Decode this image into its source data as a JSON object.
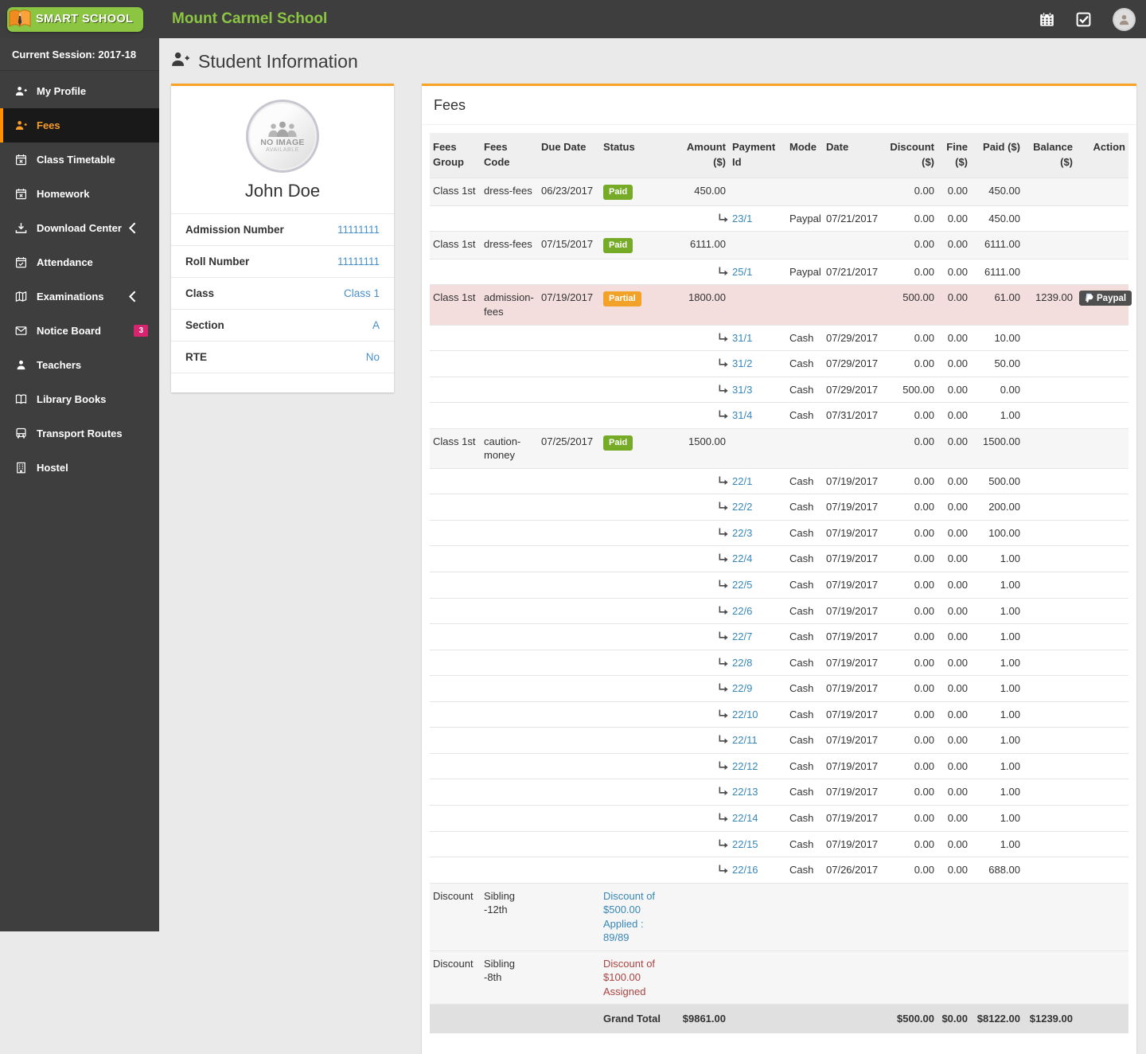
{
  "header": {
    "logo_text": "SMART SCHOOL",
    "school_name": "Mount Carmel School"
  },
  "sidebar": {
    "session_label": "Current Session: 2017-18",
    "items": [
      {
        "label": "My Profile",
        "icon": "user-plus",
        "active": false
      },
      {
        "label": "Fees",
        "icon": "user-plus",
        "active": true
      },
      {
        "label": "Class Timetable",
        "icon": "calendar-x",
        "active": false
      },
      {
        "label": "Homework",
        "icon": "calendar-x",
        "active": false
      },
      {
        "label": "Download Center",
        "icon": "download",
        "active": false,
        "chevron": true
      },
      {
        "label": "Attendance",
        "icon": "calendar-check",
        "active": false
      },
      {
        "label": "Examinations",
        "icon": "map",
        "active": false,
        "chevron": true
      },
      {
        "label": "Notice Board",
        "icon": "envelope",
        "active": false,
        "badge": "3"
      },
      {
        "label": "Teachers",
        "icon": "user",
        "active": false
      },
      {
        "label": "Library Books",
        "icon": "book",
        "active": false
      },
      {
        "label": "Transport Routes",
        "icon": "bus",
        "active": false
      },
      {
        "label": "Hostel",
        "icon": "building",
        "active": false
      }
    ]
  },
  "page": {
    "title": "Student Information"
  },
  "student": {
    "photo": {
      "line1": "NO IMAGE",
      "line2": "AVAILABLE"
    },
    "name": "John Doe",
    "fields": [
      {
        "label": "Admission Number",
        "value": "11111111"
      },
      {
        "label": "Roll Number",
        "value": "11111111"
      },
      {
        "label": "Class",
        "value": "Class 1"
      },
      {
        "label": "Section",
        "value": "A"
      },
      {
        "label": "RTE",
        "value": "No"
      }
    ]
  },
  "fees": {
    "panel_title": "Fees",
    "columns": [
      "Fees Group",
      "Fees Code",
      "Due Date",
      "Status",
      "Amount ($)",
      "Payment Id",
      "Mode",
      "Date",
      "Discount ($)",
      "Fine ($)",
      "Paid ($)",
      "Balance ($)",
      "Action"
    ],
    "rows": [
      {
        "type": "fee",
        "group": "Class 1st",
        "code": "dress-fees",
        "due_date": "06/23/2017",
        "status": "Paid",
        "status_type": "paid",
        "amount": "450.00",
        "discount": "0.00",
        "fine": "0.00",
        "paid": "450.00",
        "balance": "",
        "action": "",
        "highlight": false
      },
      {
        "type": "payment",
        "id": "23/1",
        "mode": "Paypal",
        "date": "07/21/2017",
        "discount": "0.00",
        "fine": "0.00",
        "paid": "450.00"
      },
      {
        "type": "fee",
        "group": "Class 1st",
        "code": "dress-fees",
        "due_date": "07/15/2017",
        "status": "Paid",
        "status_type": "paid",
        "amount": "6111.00",
        "discount": "0.00",
        "fine": "0.00",
        "paid": "6111.00",
        "balance": "",
        "action": "",
        "highlight": false
      },
      {
        "type": "payment",
        "id": "25/1",
        "mode": "Paypal",
        "date": "07/21/2017",
        "discount": "0.00",
        "fine": "0.00",
        "paid": "6111.00"
      },
      {
        "type": "fee",
        "group": "Class 1st",
        "code": "admission-fees",
        "due_date": "07/19/2017",
        "status": "Partial",
        "status_type": "partial",
        "amount": "1800.00",
        "discount": "500.00",
        "fine": "0.00",
        "paid": "61.00",
        "balance": "1239.00",
        "action": "Paypal",
        "highlight": true
      },
      {
        "type": "payment",
        "id": "31/1",
        "mode": "Cash",
        "date": "07/29/2017",
        "discount": "0.00",
        "fine": "0.00",
        "paid": "10.00"
      },
      {
        "type": "payment",
        "id": "31/2",
        "mode": "Cash",
        "date": "07/29/2017",
        "discount": "0.00",
        "fine": "0.00",
        "paid": "50.00"
      },
      {
        "type": "payment",
        "id": "31/3",
        "mode": "Cash",
        "date": "07/29/2017",
        "discount": "500.00",
        "fine": "0.00",
        "paid": "0.00"
      },
      {
        "type": "payment",
        "id": "31/4",
        "mode": "Cash",
        "date": "07/31/2017",
        "discount": "0.00",
        "fine": "0.00",
        "paid": "1.00"
      },
      {
        "type": "fee",
        "group": "Class 1st",
        "code": "caution-money",
        "due_date": "07/25/2017",
        "status": "Paid",
        "status_type": "paid",
        "amount": "1500.00",
        "discount": "0.00",
        "fine": "0.00",
        "paid": "1500.00",
        "balance": "",
        "action": "",
        "highlight": false
      },
      {
        "type": "payment",
        "id": "22/1",
        "mode": "Cash",
        "date": "07/19/2017",
        "discount": "0.00",
        "fine": "0.00",
        "paid": "500.00"
      },
      {
        "type": "payment",
        "id": "22/2",
        "mode": "Cash",
        "date": "07/19/2017",
        "discount": "0.00",
        "fine": "0.00",
        "paid": "200.00"
      },
      {
        "type": "payment",
        "id": "22/3",
        "mode": "Cash",
        "date": "07/19/2017",
        "discount": "0.00",
        "fine": "0.00",
        "paid": "100.00"
      },
      {
        "type": "payment",
        "id": "22/4",
        "mode": "Cash",
        "date": "07/19/2017",
        "discount": "0.00",
        "fine": "0.00",
        "paid": "1.00"
      },
      {
        "type": "payment",
        "id": "22/5",
        "mode": "Cash",
        "date": "07/19/2017",
        "discount": "0.00",
        "fine": "0.00",
        "paid": "1.00"
      },
      {
        "type": "payment",
        "id": "22/6",
        "mode": "Cash",
        "date": "07/19/2017",
        "discount": "0.00",
        "fine": "0.00",
        "paid": "1.00"
      },
      {
        "type": "payment",
        "id": "22/7",
        "mode": "Cash",
        "date": "07/19/2017",
        "discount": "0.00",
        "fine": "0.00",
        "paid": "1.00"
      },
      {
        "type": "payment",
        "id": "22/8",
        "mode": "Cash",
        "date": "07/19/2017",
        "discount": "0.00",
        "fine": "0.00",
        "paid": "1.00"
      },
      {
        "type": "payment",
        "id": "22/9",
        "mode": "Cash",
        "date": "07/19/2017",
        "discount": "0.00",
        "fine": "0.00",
        "paid": "1.00"
      },
      {
        "type": "payment",
        "id": "22/10",
        "mode": "Cash",
        "date": "07/19/2017",
        "discount": "0.00",
        "fine": "0.00",
        "paid": "1.00"
      },
      {
        "type": "payment",
        "id": "22/11",
        "mode": "Cash",
        "date": "07/19/2017",
        "discount": "0.00",
        "fine": "0.00",
        "paid": "1.00"
      },
      {
        "type": "payment",
        "id": "22/12",
        "mode": "Cash",
        "date": "07/19/2017",
        "discount": "0.00",
        "fine": "0.00",
        "paid": "1.00"
      },
      {
        "type": "payment",
        "id": "22/13",
        "mode": "Cash",
        "date": "07/19/2017",
        "discount": "0.00",
        "fine": "0.00",
        "paid": "1.00"
      },
      {
        "type": "payment",
        "id": "22/14",
        "mode": "Cash",
        "date": "07/19/2017",
        "discount": "0.00",
        "fine": "0.00",
        "paid": "1.00"
      },
      {
        "type": "payment",
        "id": "22/15",
        "mode": "Cash",
        "date": "07/19/2017",
        "discount": "0.00",
        "fine": "0.00",
        "paid": "1.00"
      },
      {
        "type": "payment",
        "id": "22/16",
        "mode": "Cash",
        "date": "07/26/2017",
        "discount": "0.00",
        "fine": "0.00",
        "paid": "688.00"
      },
      {
        "type": "discount",
        "group": "Discount",
        "code": "Sibling -12th",
        "text": "Discount of\n$500.00 Applied :\n89/89",
        "color": "blue"
      },
      {
        "type": "discount",
        "group": "Discount",
        "code": "Sibling -8th",
        "text": "Discount of\n$100.00\nAssigned",
        "color": "red"
      }
    ],
    "grand_total": {
      "label": "Grand Total",
      "amount": "$9861.00",
      "discount": "$500.00",
      "fine": "$0.00",
      "paid": "$8122.00",
      "balance": "$1239.00"
    }
  }
}
